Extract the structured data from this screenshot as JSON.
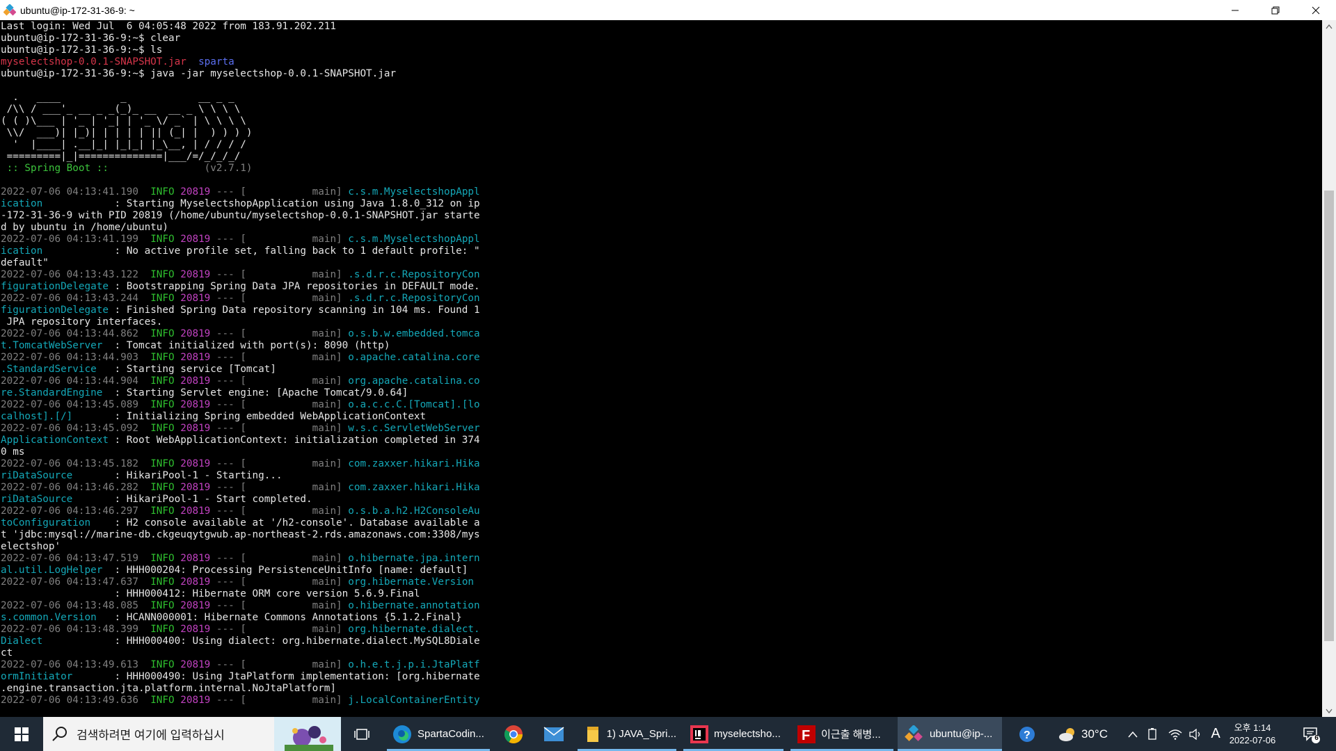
{
  "window": {
    "title": "ubuntu@ip-172-31-36-9: ~"
  },
  "terminal_lines": [
    [
      [
        "Last login: Wed Jul  6 04:05:48 2022 from 183.91.202.211",
        ""
      ]
    ],
    [
      [
        "ubuntu@ip-172-31-36-9:~$ clear",
        ""
      ]
    ],
    [
      [
        "ubuntu@ip-172-31-36-9:~$ ls",
        ""
      ]
    ],
    [
      [
        "myselectshop-0.0.1-SNAPSHOT.jar",
        "red"
      ],
      [
        "  ",
        ""
      ],
      [
        "sparta",
        "blu"
      ]
    ],
    [
      [
        "ubuntu@ip-172-31-36-9:~$ java -jar myselectshop-0.0.1-SNAPSHOT.jar",
        ""
      ]
    ],
    [
      [
        "",
        ""
      ]
    ],
    [
      [
        "  .   ____          _            __ _ _",
        ""
      ]
    ],
    [
      [
        " /\\\\ / ___'_ __ _ _(_)_ __  __ _ \\ \\ \\ \\",
        ""
      ]
    ],
    [
      [
        "( ( )\\___ | '_ | '_| | '_ \\/ _` | \\ \\ \\ \\",
        ""
      ]
    ],
    [
      [
        " \\\\/  ___)| |_)| | | | | || (_| |  ) ) ) )",
        ""
      ]
    ],
    [
      [
        "  '  |____| .__|_| |_|_| |_\\__, | / / / /",
        ""
      ]
    ],
    [
      [
        " =========|_|==============|___/=/_/_/_/",
        ""
      ]
    ],
    [
      [
        " :: Spring Boot ::",
        "boot"
      ],
      [
        "                (v2.7.1)",
        "dim"
      ]
    ],
    [
      [
        "",
        ""
      ]
    ],
    [
      [
        "2022-07-06 04:13:41.190",
        "dim"
      ],
      [
        "  INFO ",
        "grn"
      ],
      [
        "20819",
        "mag"
      ],
      [
        " --- [           main] ",
        "dim"
      ],
      [
        "c.s.m.MyselectshopAppl",
        "cyn"
      ]
    ],
    [
      [
        "ication",
        "cyn"
      ],
      [
        "            : Starting MyselectshopApplication using Java 1.8.0_312 on ip",
        ""
      ]
    ],
    [
      [
        "-172-31-36-9 with PID 20819 (/home/ubuntu/myselectshop-0.0.1-SNAPSHOT.jar starte",
        ""
      ]
    ],
    [
      [
        "d by ubuntu in /home/ubuntu)",
        ""
      ]
    ],
    [
      [
        "2022-07-06 04:13:41.199",
        "dim"
      ],
      [
        "  INFO ",
        "grn"
      ],
      [
        "20819",
        "mag"
      ],
      [
        " --- [           main] ",
        "dim"
      ],
      [
        "c.s.m.MyselectshopAppl",
        "cyn"
      ]
    ],
    [
      [
        "ication",
        "cyn"
      ],
      [
        "            : No active profile set, falling back to 1 default profile: \"",
        ""
      ]
    ],
    [
      [
        "default\"",
        ""
      ]
    ],
    [
      [
        "2022-07-06 04:13:43.122",
        "dim"
      ],
      [
        "  INFO ",
        "grn"
      ],
      [
        "20819",
        "mag"
      ],
      [
        " --- [           main] ",
        "dim"
      ],
      [
        ".s.d.r.c.RepositoryCon",
        "cyn"
      ]
    ],
    [
      [
        "figurationDelegate",
        "cyn"
      ],
      [
        " : Bootstrapping Spring Data JPA repositories in DEFAULT mode.",
        ""
      ]
    ],
    [
      [
        "2022-07-06 04:13:43.244",
        "dim"
      ],
      [
        "  INFO ",
        "grn"
      ],
      [
        "20819",
        "mag"
      ],
      [
        " --- [           main] ",
        "dim"
      ],
      [
        ".s.d.r.c.RepositoryCon",
        "cyn"
      ]
    ],
    [
      [
        "figurationDelegate",
        "cyn"
      ],
      [
        " : Finished Spring Data repository scanning in 104 ms. Found 1",
        ""
      ]
    ],
    [
      [
        " JPA repository interfaces.",
        ""
      ]
    ],
    [
      [
        "2022-07-06 04:13:44.862",
        "dim"
      ],
      [
        "  INFO ",
        "grn"
      ],
      [
        "20819",
        "mag"
      ],
      [
        " --- [           main] ",
        "dim"
      ],
      [
        "o.s.b.w.embedded.tomca",
        "cyn"
      ]
    ],
    [
      [
        "t.TomcatWebServer",
        "cyn"
      ],
      [
        "  : Tomcat initialized with port(s): 8090 (http)",
        ""
      ]
    ],
    [
      [
        "2022-07-06 04:13:44.903",
        "dim"
      ],
      [
        "  INFO ",
        "grn"
      ],
      [
        "20819",
        "mag"
      ],
      [
        " --- [           main] ",
        "dim"
      ],
      [
        "o.apache.catalina.core",
        "cyn"
      ]
    ],
    [
      [
        ".StandardService",
        "cyn"
      ],
      [
        "   : Starting service [Tomcat]",
        ""
      ]
    ],
    [
      [
        "2022-07-06 04:13:44.904",
        "dim"
      ],
      [
        "  INFO ",
        "grn"
      ],
      [
        "20819",
        "mag"
      ],
      [
        " --- [           main] ",
        "dim"
      ],
      [
        "org.apache.catalina.co",
        "cyn"
      ]
    ],
    [
      [
        "re.StandardEngine",
        "cyn"
      ],
      [
        "  : Starting Servlet engine: [Apache Tomcat/9.0.64]",
        ""
      ]
    ],
    [
      [
        "2022-07-06 04:13:45.089",
        "dim"
      ],
      [
        "  INFO ",
        "grn"
      ],
      [
        "20819",
        "mag"
      ],
      [
        " --- [           main] ",
        "dim"
      ],
      [
        "o.a.c.c.C.[Tomcat].[lo",
        "cyn"
      ]
    ],
    [
      [
        "calhost].[/]",
        "cyn"
      ],
      [
        "       : Initializing Spring embedded WebApplicationContext",
        ""
      ]
    ],
    [
      [
        "2022-07-06 04:13:45.092",
        "dim"
      ],
      [
        "  INFO ",
        "grn"
      ],
      [
        "20819",
        "mag"
      ],
      [
        " --- [           main] ",
        "dim"
      ],
      [
        "w.s.c.ServletWebServer",
        "cyn"
      ]
    ],
    [
      [
        "ApplicationContext",
        "cyn"
      ],
      [
        " : Root WebApplicationContext: initialization completed in 374",
        ""
      ]
    ],
    [
      [
        "0 ms",
        ""
      ]
    ],
    [
      [
        "2022-07-06 04:13:45.182",
        "dim"
      ],
      [
        "  INFO ",
        "grn"
      ],
      [
        "20819",
        "mag"
      ],
      [
        " --- [           main] ",
        "dim"
      ],
      [
        "com.zaxxer.hikari.Hika",
        "cyn"
      ]
    ],
    [
      [
        "riDataSource",
        "cyn"
      ],
      [
        "       : HikariPool-1 - Starting...",
        ""
      ]
    ],
    [
      [
        "2022-07-06 04:13:46.282",
        "dim"
      ],
      [
        "  INFO ",
        "grn"
      ],
      [
        "20819",
        "mag"
      ],
      [
        " --- [           main] ",
        "dim"
      ],
      [
        "com.zaxxer.hikari.Hika",
        "cyn"
      ]
    ],
    [
      [
        "riDataSource",
        "cyn"
      ],
      [
        "       : HikariPool-1 - Start completed.",
        ""
      ]
    ],
    [
      [
        "2022-07-06 04:13:46.297",
        "dim"
      ],
      [
        "  INFO ",
        "grn"
      ],
      [
        "20819",
        "mag"
      ],
      [
        " --- [           main] ",
        "dim"
      ],
      [
        "o.s.b.a.h2.H2ConsoleAu",
        "cyn"
      ]
    ],
    [
      [
        "toConfiguration",
        "cyn"
      ],
      [
        "    : H2 console available at '/h2-console'. Database available a",
        ""
      ]
    ],
    [
      [
        "t 'jdbc:mysql://marine-db.ckgeuqytgwub.ap-northeast-2.rds.amazonaws.com:3308/mys",
        ""
      ]
    ],
    [
      [
        "electshop'",
        ""
      ]
    ],
    [
      [
        "2022-07-06 04:13:47.519",
        "dim"
      ],
      [
        "  INFO ",
        "grn"
      ],
      [
        "20819",
        "mag"
      ],
      [
        " --- [           main] ",
        "dim"
      ],
      [
        "o.hibernate.jpa.intern",
        "cyn"
      ]
    ],
    [
      [
        "al.util.LogHelper",
        "cyn"
      ],
      [
        "  : HHH000204: Processing PersistenceUnitInfo [name: default]",
        ""
      ]
    ],
    [
      [
        "2022-07-06 04:13:47.637",
        "dim"
      ],
      [
        "  INFO ",
        "grn"
      ],
      [
        "20819",
        "mag"
      ],
      [
        " --- [           main] ",
        "dim"
      ],
      [
        "org.hibernate.Version",
        "cyn"
      ]
    ],
    [
      [
        "                   : HHH000412: Hibernate ORM core version 5.6.9.Final",
        ""
      ]
    ],
    [
      [
        "2022-07-06 04:13:48.085",
        "dim"
      ],
      [
        "  INFO ",
        "grn"
      ],
      [
        "20819",
        "mag"
      ],
      [
        " --- [           main] ",
        "dim"
      ],
      [
        "o.hibernate.annotation",
        "cyn"
      ]
    ],
    [
      [
        "s.common.Version",
        "cyn"
      ],
      [
        "   : HCANN000001: Hibernate Commons Annotations {5.1.2.Final}",
        ""
      ]
    ],
    [
      [
        "2022-07-06 04:13:48.399",
        "dim"
      ],
      [
        "  INFO ",
        "grn"
      ],
      [
        "20819",
        "mag"
      ],
      [
        " --- [           main] ",
        "dim"
      ],
      [
        "org.hibernate.dialect.",
        "cyn"
      ]
    ],
    [
      [
        "Dialect",
        "cyn"
      ],
      [
        "            : HHH000400: Using dialect: org.hibernate.dialect.MySQL8Diale",
        ""
      ]
    ],
    [
      [
        "ct",
        ""
      ]
    ],
    [
      [
        "2022-07-06 04:13:49.613",
        "dim"
      ],
      [
        "  INFO ",
        "grn"
      ],
      [
        "20819",
        "mag"
      ],
      [
        " --- [           main] ",
        "dim"
      ],
      [
        "o.h.e.t.j.p.i.JtaPlatf",
        "cyn"
      ]
    ],
    [
      [
        "ormInitiator",
        "cyn"
      ],
      [
        "       : HHH000490: Using JtaPlatform implementation: [org.hibernate",
        ""
      ]
    ],
    [
      [
        ".engine.transaction.jta.platform.internal.NoJtaPlatform]",
        ""
      ]
    ],
    [
      [
        "2022-07-06 04:13:49.636",
        "dim"
      ],
      [
        "  INFO ",
        "grn"
      ],
      [
        "20819",
        "mag"
      ],
      [
        " --- [           main] ",
        "dim"
      ],
      [
        "j.LocalContainerEntity",
        "cyn"
      ]
    ]
  ],
  "taskbar": {
    "search_placeholder": "검색하려면 여기에 입력하십시",
    "apps": [
      {
        "label": "SpartaCodin..."
      },
      {
        "label": "1) JAVA_Spri..."
      },
      {
        "label": "myselectsho..."
      },
      {
        "label": "이근출 해병..."
      },
      {
        "label": "ubuntu@ip-..."
      }
    ],
    "weather": "30°C",
    "ime": "A",
    "time": "오후 1:14",
    "date": "2022-07-06",
    "notification_count": "6"
  },
  "colors": {
    "taskbar_bg": "#1f2a36",
    "accent": "#76b9ed",
    "terminal_bg": "#000000"
  }
}
